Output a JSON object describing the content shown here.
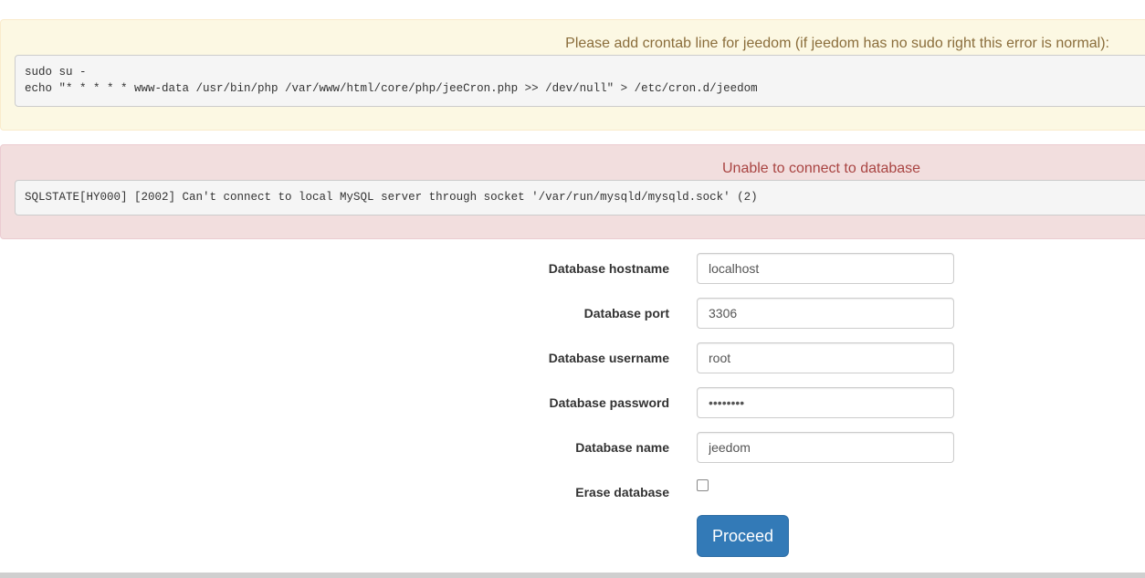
{
  "crontab_alert": {
    "title": "Please add crontab line for jeedom (if jeedom has no sudo right this error is normal):",
    "code": "sudo su -\necho \"* * * * * www-data /usr/bin/php /var/www/html/core/php/jeeCron.php >> /dev/null\" > /etc/cron.d/jeedom"
  },
  "db_alert": {
    "title": "Unable to connect to database",
    "code": "SQLSTATE[HY000] [2002] Can't connect to local MySQL server through socket '/var/run/mysqld/mysqld.sock' (2)"
  },
  "form": {
    "hostname": {
      "label": "Database hostname",
      "value": "localhost"
    },
    "port": {
      "label": "Database port",
      "value": "3306"
    },
    "username": {
      "label": "Database username",
      "value": "root"
    },
    "password": {
      "label": "Database password",
      "value": "••••••••"
    },
    "dbname": {
      "label": "Database name",
      "value": "jeedom"
    },
    "erase": {
      "label": "Erase database",
      "checked": false
    },
    "submit_label": "Proceed"
  },
  "colors": {
    "warning_bg": "#fcf8e3",
    "warning_text": "#8a6d3b",
    "danger_bg": "#f2dede",
    "danger_text": "#a94442",
    "primary": "#337ab7"
  }
}
